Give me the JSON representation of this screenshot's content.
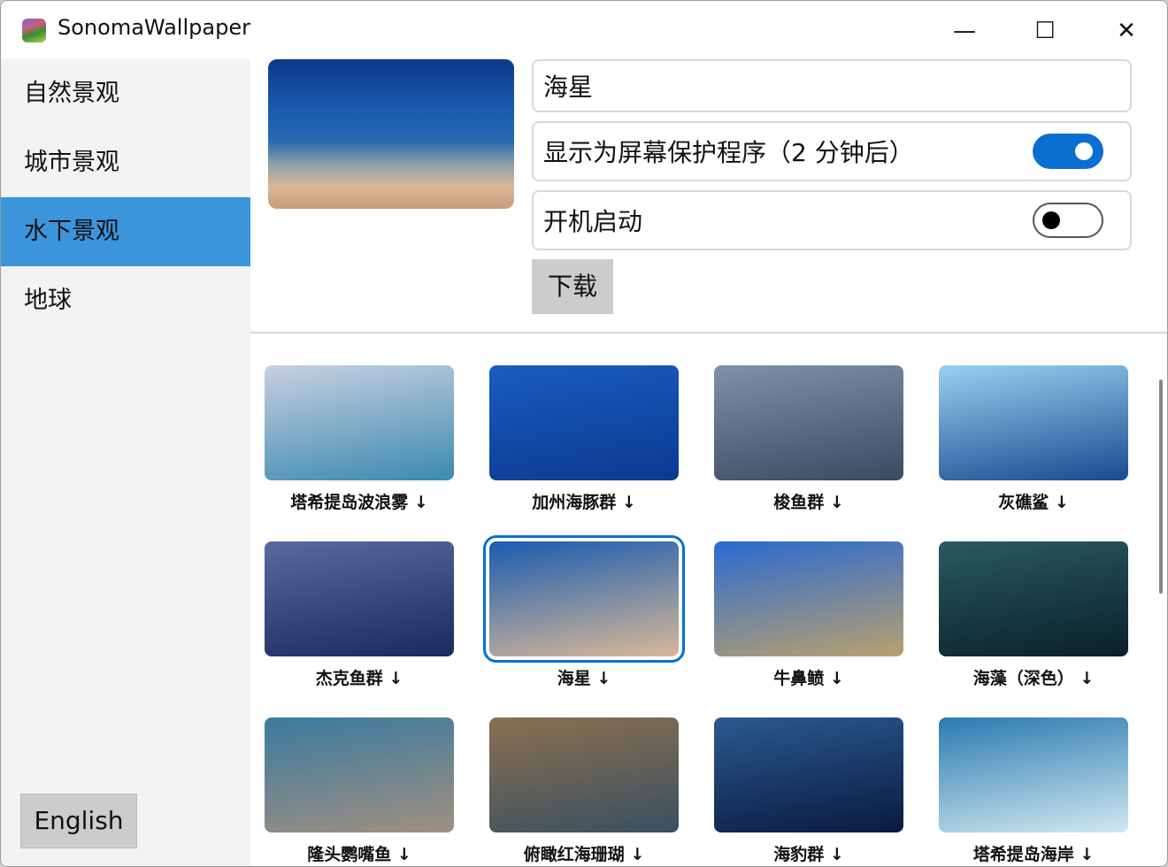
{
  "app": {
    "title": "SonomaWallpaper"
  },
  "window_controls": {
    "minimize": "—",
    "maximize": "☐",
    "close": "✕"
  },
  "sidebar": {
    "items": [
      {
        "label": "自然景观"
      },
      {
        "label": "城市景观"
      },
      {
        "label": "水下景观",
        "selected": true
      },
      {
        "label": "地球"
      }
    ],
    "language_button": "English"
  },
  "detail": {
    "name_value": "海星",
    "screensaver_label": "显示为屏幕保护程序（2 分钟后）",
    "screensaver_on": true,
    "startup_label": "开机启动",
    "startup_on": false,
    "download_label": "下载"
  },
  "grid": {
    "items": [
      {
        "label": "塔希提岛波浪雾 ↓",
        "colors": [
          "#c8d0e0",
          "#3a8ab0"
        ]
      },
      {
        "label": "加州海豚群 ↓",
        "colors": [
          "#1a5cc0",
          "#0a3a90"
        ]
      },
      {
        "label": "梭鱼群 ↓",
        "colors": [
          "#8090a8",
          "#3a4a60"
        ]
      },
      {
        "label": "灰礁鲨 ↓",
        "colors": [
          "#9ad0f0",
          "#1a4a90"
        ]
      },
      {
        "label": "杰克鱼群 ↓",
        "colors": [
          "#5a6aa0",
          "#1a2a60"
        ]
      },
      {
        "label": "海星 ↓",
        "colors": [
          "#1a5cb0",
          "#d8b898"
        ],
        "selected": true
      },
      {
        "label": "牛鼻鲼 ↓",
        "colors": [
          "#2a6ad0",
          "#b8a070"
        ]
      },
      {
        "label": "海藻（深色） ↓",
        "colors": [
          "#2a5a60",
          "#0a2028"
        ]
      },
      {
        "label": "隆头鹦嘴鱼 ↓",
        "colors": [
          "#3a7aa0",
          "#a09080"
        ]
      },
      {
        "label": "俯瞰红海珊瑚 ↓",
        "colors": [
          "#8a7050",
          "#3a5060"
        ]
      },
      {
        "label": "海豹群 ↓",
        "colors": [
          "#2a5a90",
          "#0a1a40"
        ]
      },
      {
        "label": "塔希提岛海岸 ↓",
        "colors": [
          "#2a7ab0",
          "#d0e8f0"
        ]
      }
    ]
  },
  "colors": {
    "accent": "#0a6fd0",
    "sidebar_selected": "#3a95dc"
  }
}
